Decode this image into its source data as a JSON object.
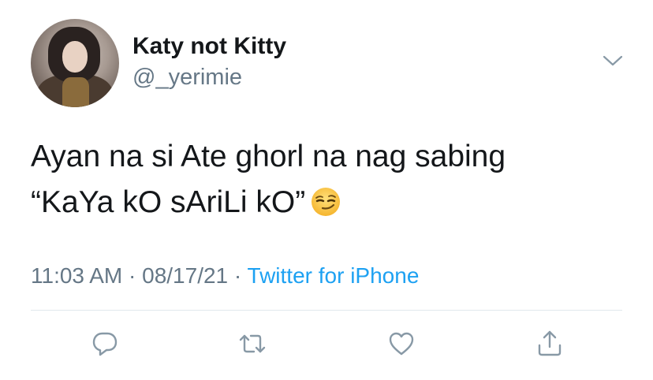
{
  "tweet": {
    "author": {
      "display_name": "Katy not Kitty",
      "handle": "@_yerimie"
    },
    "text_lines": [
      "Ayan na si Ate ghorl na nag sabing",
      "“KaYa kO sAriLi kO”"
    ],
    "emoji": "smirking-face",
    "time": "11:03 AM",
    "date": "08/17/21",
    "separator": "·",
    "source": "Twitter for iPhone"
  },
  "icons": {
    "menu": "chevron-down-icon",
    "reply": "reply-icon",
    "retweet": "retweet-icon",
    "like": "heart-icon",
    "share": "share-icon"
  },
  "colors": {
    "text": "#14171a",
    "secondary": "#657786",
    "link": "#1da1f2",
    "divider": "#e1e8ed"
  }
}
